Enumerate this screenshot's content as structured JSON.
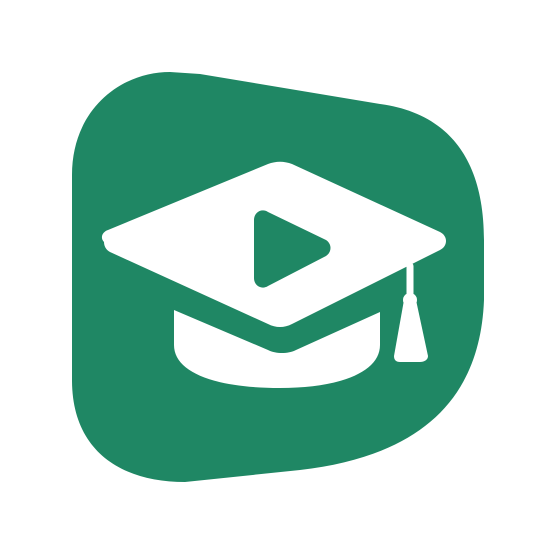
{
  "app_icon": {
    "icon": "graduation-cap-play-icon",
    "colors": {
      "background": "#ffffff",
      "badge": "#1f8764",
      "cap": "#ffffff",
      "play": "#1f8764"
    }
  }
}
